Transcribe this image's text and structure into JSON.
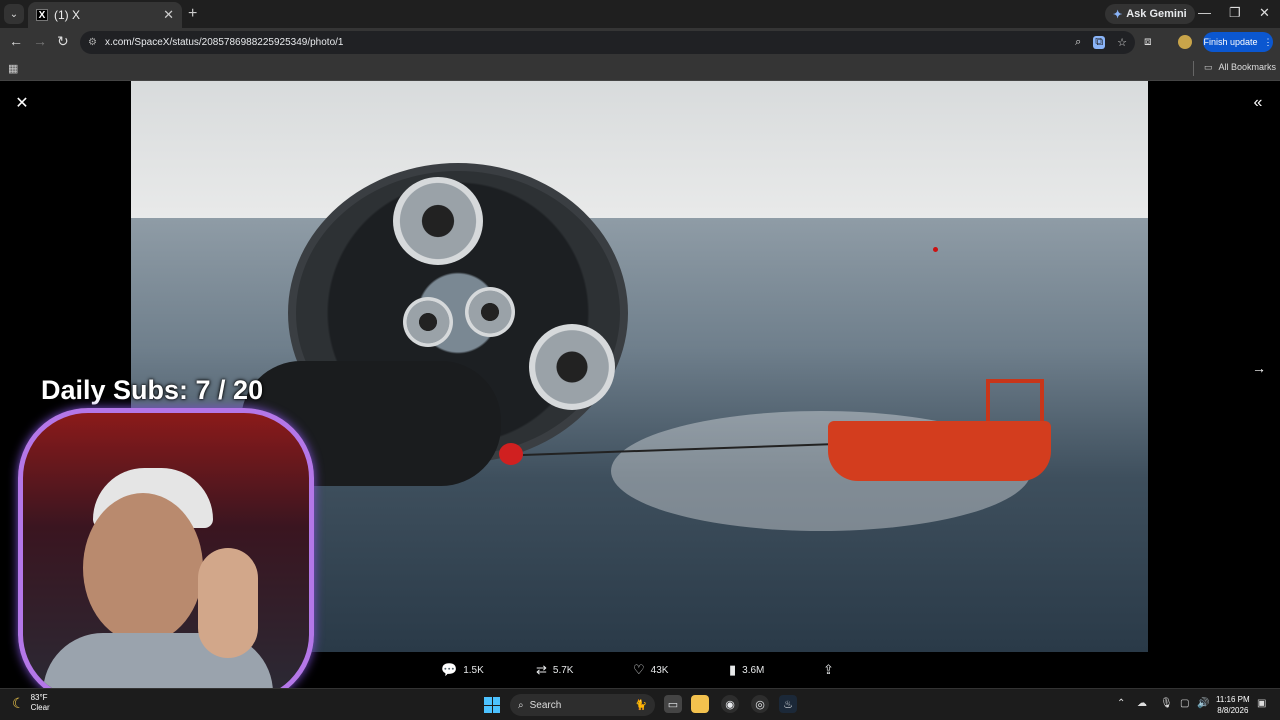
{
  "browser": {
    "tab_title": "(1) X",
    "tab_favicon": "X",
    "url": "x.com/SpaceX/status/2085786988225925349/photo/1",
    "ask_gemini_label": "Ask Gemini",
    "finish_update_label": "Finish update",
    "all_bookmarks_label": "All Bookmarks"
  },
  "post": {
    "replies": "1.5K",
    "reposts": "5.7K",
    "likes": "43K",
    "views": "3.6M"
  },
  "overlay": {
    "daily_subs": "Daily Subs: 7 / 20"
  },
  "taskbar": {
    "temperature": "83°F",
    "condition": "Clear",
    "search_placeholder": "Search",
    "time": "11:16 PM",
    "date": "8/8/2026"
  },
  "colors": {
    "accent_blue": "#0b57d0",
    "webcam_border": "#b477e8",
    "start_blue": "#4cc2ff"
  }
}
